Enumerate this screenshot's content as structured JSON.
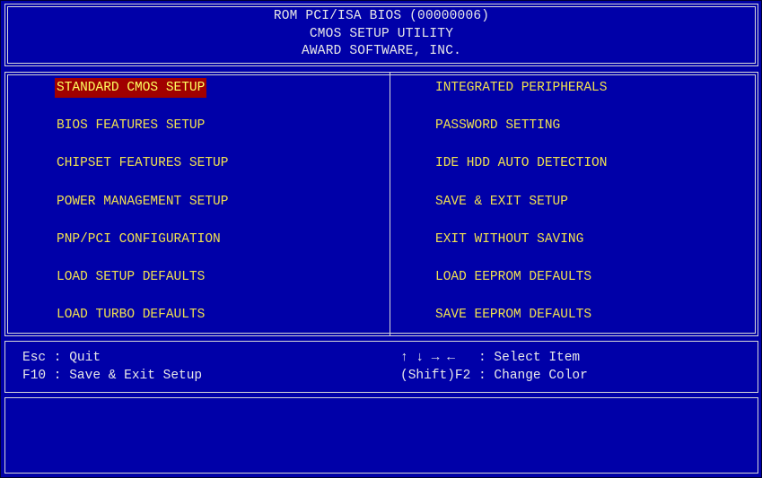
{
  "header": {
    "line1": "ROM PCI/ISA BIOS (00000006)",
    "line2": "CMOS SETUP UTILITY",
    "line3": "AWARD SOFTWARE, INC."
  },
  "menu": {
    "left": [
      {
        "label": "STANDARD CMOS SETUP",
        "selected": true
      },
      {
        "label": "BIOS FEATURES SETUP"
      },
      {
        "label": "CHIPSET FEATURES SETUP"
      },
      {
        "label": "POWER MANAGEMENT SETUP"
      },
      {
        "label": "PNP/PCI CONFIGURATION"
      },
      {
        "label": "LOAD SETUP DEFAULTS"
      },
      {
        "label": "LOAD TURBO DEFAULTS"
      }
    ],
    "right": [
      {
        "label": "INTEGRATED PERIPHERALS"
      },
      {
        "label": "PASSWORD SETTING"
      },
      {
        "label": "IDE HDD AUTO DETECTION"
      },
      {
        "label": "SAVE & EXIT SETUP"
      },
      {
        "label": "EXIT WITHOUT SAVING"
      },
      {
        "label": "LOAD EEPROM DEFAULTS"
      },
      {
        "label": "SAVE EEPROM DEFAULTS"
      }
    ]
  },
  "keys": {
    "left": [
      "Esc : Quit",
      "F10 : Save & Exit Setup"
    ],
    "right": [
      "↑ ↓ → ←   : Select Item",
      "(Shift)F2 : Change Color"
    ]
  },
  "description": "",
  "colors": {
    "background": "#0000a8",
    "menu_text": "#f0e050",
    "highlight": "#a00000",
    "border": "#d8d8d8",
    "plain_text": "#e8e8e8"
  }
}
